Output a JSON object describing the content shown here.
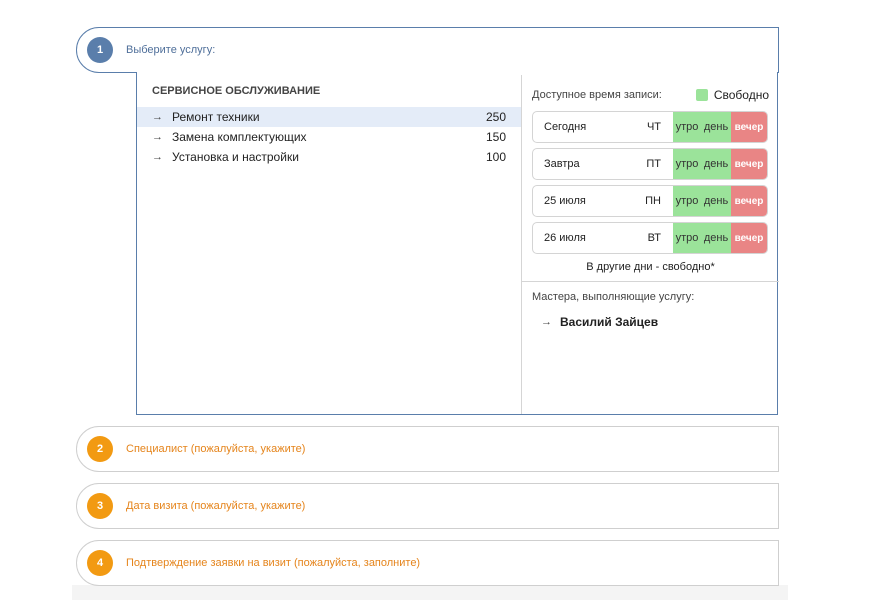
{
  "steps": [
    {
      "num": "1",
      "title": "Выберите услугу:",
      "state": "active"
    },
    {
      "num": "2",
      "title": "Специалист (пожалуйста, укажите)",
      "state": "pending"
    },
    {
      "num": "3",
      "title": "Дата визита (пожалуйста, укажите)",
      "state": "pending"
    },
    {
      "num": "4",
      "title": "Подтверждение заявки на визит (пожалуйста, заполните)",
      "state": "pending"
    }
  ],
  "services": {
    "category": "СЕРВИСНОЕ ОБСЛУЖИВАНИЕ",
    "items": [
      {
        "name": "Ремонт техники",
        "price": "250",
        "selected": true
      },
      {
        "name": "Замена комплектующих",
        "price": "150",
        "selected": false
      },
      {
        "name": "Установка и настройки",
        "price": "100",
        "selected": false
      }
    ]
  },
  "availability": {
    "heading": "Доступное время записи:",
    "legend_label": "Свободно",
    "slot_labels": {
      "morning": "утро",
      "day": "день",
      "evening": "вечер"
    },
    "days": [
      {
        "date": "Сегодня",
        "dow": "ЧТ"
      },
      {
        "date": "Завтра",
        "dow": "ПТ"
      },
      {
        "date": "25 июля",
        "dow": "ПН"
      },
      {
        "date": "26 июля",
        "dow": "ВТ"
      }
    ],
    "other_days": "В другие дни - свободно*"
  },
  "masters": {
    "heading": "Мастера, выполняющие услугу:",
    "items": [
      "Василий Зайцев"
    ]
  },
  "colors": {
    "accent_blue": "#5a7eab",
    "accent_orange": "#f29a12",
    "free_green": "#9be39a",
    "busy_red": "#e98585",
    "selected_row": "#e4ecf8"
  }
}
